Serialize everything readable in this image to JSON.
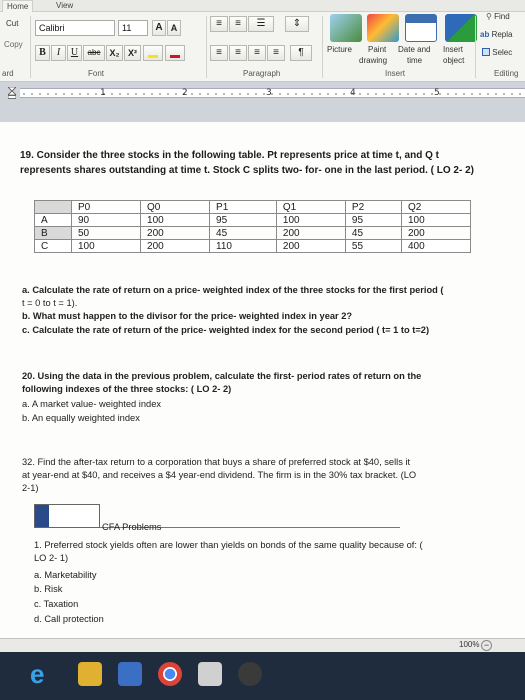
{
  "ribbon": {
    "tabs": [
      "Home",
      "View"
    ],
    "clipboard": {
      "cut": "Cut",
      "copy": "Copy",
      "group": "ard"
    },
    "font": {
      "name": "Calibri",
      "size": "11",
      "grow": "A",
      "shrink": "A",
      "bold": "B",
      "italic": "I",
      "underline": "U",
      "strike": "abc",
      "subscript": "X₂",
      "superscript": "X²",
      "group": "Font"
    },
    "paragraph": {
      "group": "Paragraph"
    },
    "insert": {
      "picture": "Picture",
      "paint": "Paint",
      "drawing": "drawing",
      "datetime": "Date and",
      "time": "time",
      "insert_object": "Insert",
      "object": "object",
      "group": "Insert"
    },
    "editing": {
      "find": "Find",
      "replace": "Repla",
      "select": "Selec",
      "group": "Editing"
    }
  },
  "ruler": {
    "numbers": [
      "1",
      "2",
      "3",
      "4",
      "5"
    ]
  },
  "document": {
    "q19_line1": "19. Consider the three stocks in the following table. Pt represents price at time t, and Q t",
    "q19_line2": "represents shares outstanding at time t. Stock C splits two- for- one in the last period. ( LO 2- 2)",
    "table": {
      "headers": [
        "P0",
        "Q0",
        "P1",
        "Q1",
        "P2",
        "Q2"
      ],
      "rows": [
        {
          "label": "A",
          "values": [
            "90",
            "100",
            "95",
            "100",
            "95",
            "100"
          ]
        },
        {
          "label": "B",
          "values": [
            "50",
            "200",
            "45",
            "200",
            "45",
            "200"
          ]
        },
        {
          "label": "C",
          "values": [
            "100",
            "200",
            "110",
            "200",
            "55",
            "400"
          ]
        }
      ]
    },
    "q19a_1": "a. Calculate the rate of return on a price- weighted index of the three stocks for the first period (",
    "q19a_2": "t = 0 to t = 1).",
    "q19b": "b. What must happen to the divisor for the price- weighted index in year 2?",
    "q19c": "c. Calculate the rate of return of the price- weighted index for the second period ( t= 1 to t=2)",
    "q20_1": "20. Using the data in the previous problem, calculate the first- period rates of return on the",
    "q20_2": "following indexes of the three stocks: ( LO 2- 2)",
    "q20a": "a. A market value- weighted index",
    "q20b": "b. An equally weighted index",
    "q32_1": "32. Find the after-tax return to a corporation that buys a share of preferred stock at $40, sells it",
    "q32_2": "at year-end at $40, and receives a $4 year-end dividend. The firm is in the 30% tax bracket. (LO",
    "q32_3": "2-1)",
    "cfa_title": "CFA Problems",
    "cfa1_1": "1. Preferred stock yields often are lower than yields on bonds of the same quality because of: (",
    "cfa1_2": "LO 2- 1)",
    "cfa_a": "a. Marketability",
    "cfa_b": "b. Risk",
    "cfa_c": "c. Taxation",
    "cfa_d": "d. Call protection"
  },
  "status": {
    "zoom": "100%"
  },
  "colors": {
    "ribbon_bg": "#f4f4f1",
    "taskbar": "#1f2c3e",
    "table_label_bg": "#d9d9d9"
  }
}
